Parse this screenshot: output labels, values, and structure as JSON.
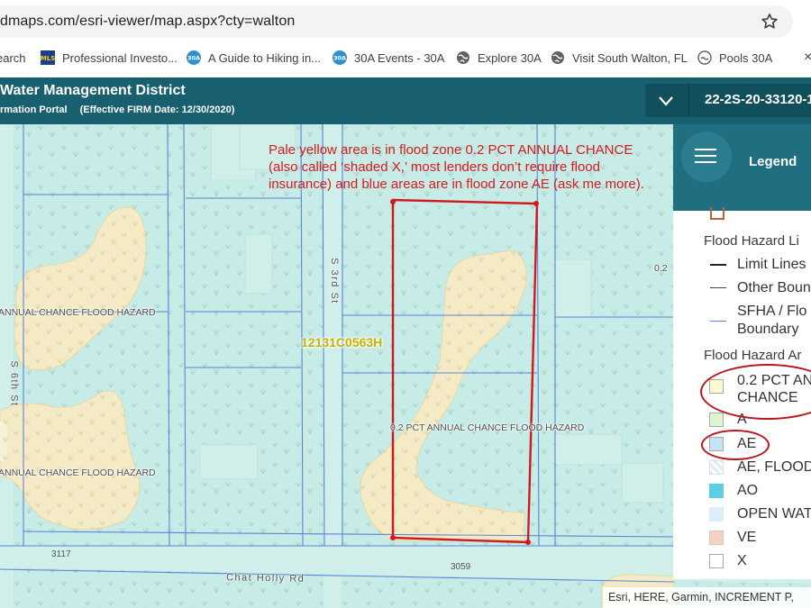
{
  "browser": {
    "url": "dmaps.com/esri-viewer/map.aspx?cty=walton",
    "bookmarks": [
      {
        "label": "earch",
        "icon": "search-bookmark-icon"
      },
      {
        "label": "Professional Investo...",
        "icon": "mls-logo-icon"
      },
      {
        "label": "A Guide to Hiking in...",
        "icon": "30a-logo-icon"
      },
      {
        "label": "30A Events - 30A",
        "icon": "30a-logo-icon"
      },
      {
        "label": "Explore 30A",
        "icon": "globe-icon"
      },
      {
        "label": "Visit South Walton, FL",
        "icon": "globe-icon"
      },
      {
        "label": "Pools 30A",
        "icon": "pools-logo-icon"
      }
    ],
    "overflow_label": "×"
  },
  "header": {
    "title": "Water Management District",
    "subtitle": "rmation Portal",
    "effective": "(Effective FIRM Date: 12/30/2020)",
    "parcel_id": "22-2S-20-33120-1"
  },
  "map": {
    "annotation": "Pale yellow area is in flood zone 0.2 PCT ANNUAL CHANCE (also called ‘shaded X,’ most lenders don’t require flood insurance) and blue areas are in flood zone AE (ask me more).",
    "panel_id": "12131C0563H",
    "zone_labels": [
      "ANNUAL CHANCE FLOOD HAZARD",
      "ANNUAL CHANCE FLOOD HAZARD",
      "0.2 PCT ANNUAL CHANCE FLOOD HAZARD",
      "0.2"
    ],
    "roads": {
      "third": "S 3rd St",
      "sixth": "S 6th St",
      "chat_holly": "Chat Holly Rd"
    },
    "addresses": [
      "3117",
      "3059"
    ],
    "attribution": "Esri, HERE, Garmin, INCREMENT P,"
  },
  "legend": {
    "title": "Legend",
    "line_section": "Flood Hazard Li",
    "lines": [
      "Limit Lines",
      "Other Boun",
      "SFHA / Flo",
      "Boundary"
    ],
    "area_section": "Flood Hazard Ar",
    "areas": [
      {
        "label": "0.2 PCT AN",
        "label2": "CHANCE",
        "color": "#fbfbd2"
      },
      {
        "label": "A",
        "color": "#dff4cf"
      },
      {
        "label": "AE",
        "color": "#c5e3f5"
      },
      {
        "label": "AE, FLOOD",
        "color": "#dcedf6"
      },
      {
        "label": "AO",
        "color": "#5ccfe6"
      },
      {
        "label": "OPEN WAT",
        "color": "#dbeefa"
      },
      {
        "label": "VE",
        "color": "#f3d2c3"
      },
      {
        "label": "X",
        "color": "#ffffff"
      }
    ]
  },
  "colors": {
    "header": "#18606f",
    "legend_header": "#1f6f80",
    "ae_fill": "#c7ebe6",
    "shaded_x_fill": "#f4ebc6",
    "annotation_red": "#d51b1b",
    "parcel_line": "#3f6fd0"
  }
}
